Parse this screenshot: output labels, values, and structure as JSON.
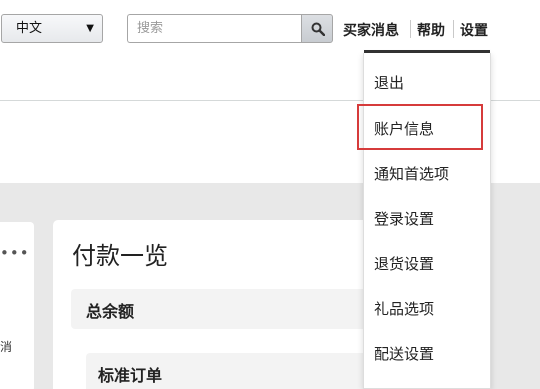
{
  "header": {
    "language_select": {
      "value": "中文",
      "caret": "▼"
    },
    "search": {
      "placeholder": "搜索",
      "button_icon": "search-icon"
    },
    "nav": {
      "buyer_messages": "买家消息",
      "help": "帮助",
      "settings": "设置"
    }
  },
  "settings_menu": {
    "items": [
      {
        "label": "退出"
      },
      {
        "label": "账户信息",
        "highlighted": true
      },
      {
        "label": "通知首选项"
      },
      {
        "label": "登录设置"
      },
      {
        "label": "退货设置"
      },
      {
        "label": "礼品选项"
      },
      {
        "label": "配送设置"
      }
    ],
    "highlight_color": "#d63b3b"
  },
  "left_card": {
    "more": "•••",
    "partial_text": "消"
  },
  "main": {
    "title": "付款一览",
    "sections": [
      {
        "label": "总余额"
      },
      {
        "label": "标准订单"
      }
    ]
  },
  "colors": {
    "band": "#e8e8e8",
    "underline": "#333333"
  }
}
